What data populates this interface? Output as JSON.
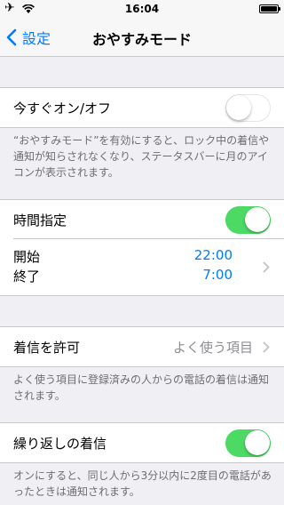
{
  "status_bar": {
    "time": "16:04",
    "airplane": "✈",
    "wifi": "wifi-icon",
    "battery": "battery-icon"
  },
  "nav": {
    "back_label": "設定",
    "title": "おやすみモード"
  },
  "manual": {
    "label": "今すぐオン/オフ",
    "enabled": false,
    "footer": "“おやすみモード”を有効にすると、ロック中の着信や通知が知らされなくなり、ステータスバーに月のアイコンが表示されます。"
  },
  "scheduled": {
    "label": "時間指定",
    "enabled": true,
    "start_label": "開始",
    "end_label": "終了",
    "start_time": "22:00",
    "end_time": "7:00"
  },
  "allow_calls": {
    "label": "着信を許可",
    "value": "よく使う項目",
    "footer": "よく使う項目に登録済みの人からの電話の着信は通知されます。"
  },
  "repeated_calls": {
    "label": "繰り返しの着信",
    "enabled": true,
    "footer": "オンにすると、同じ人から3分以内に2度目の電話があったときは通知されます。"
  },
  "colors": {
    "accent": "#007aff",
    "toggle_on": "#4cd964",
    "background": "#efeff4"
  }
}
